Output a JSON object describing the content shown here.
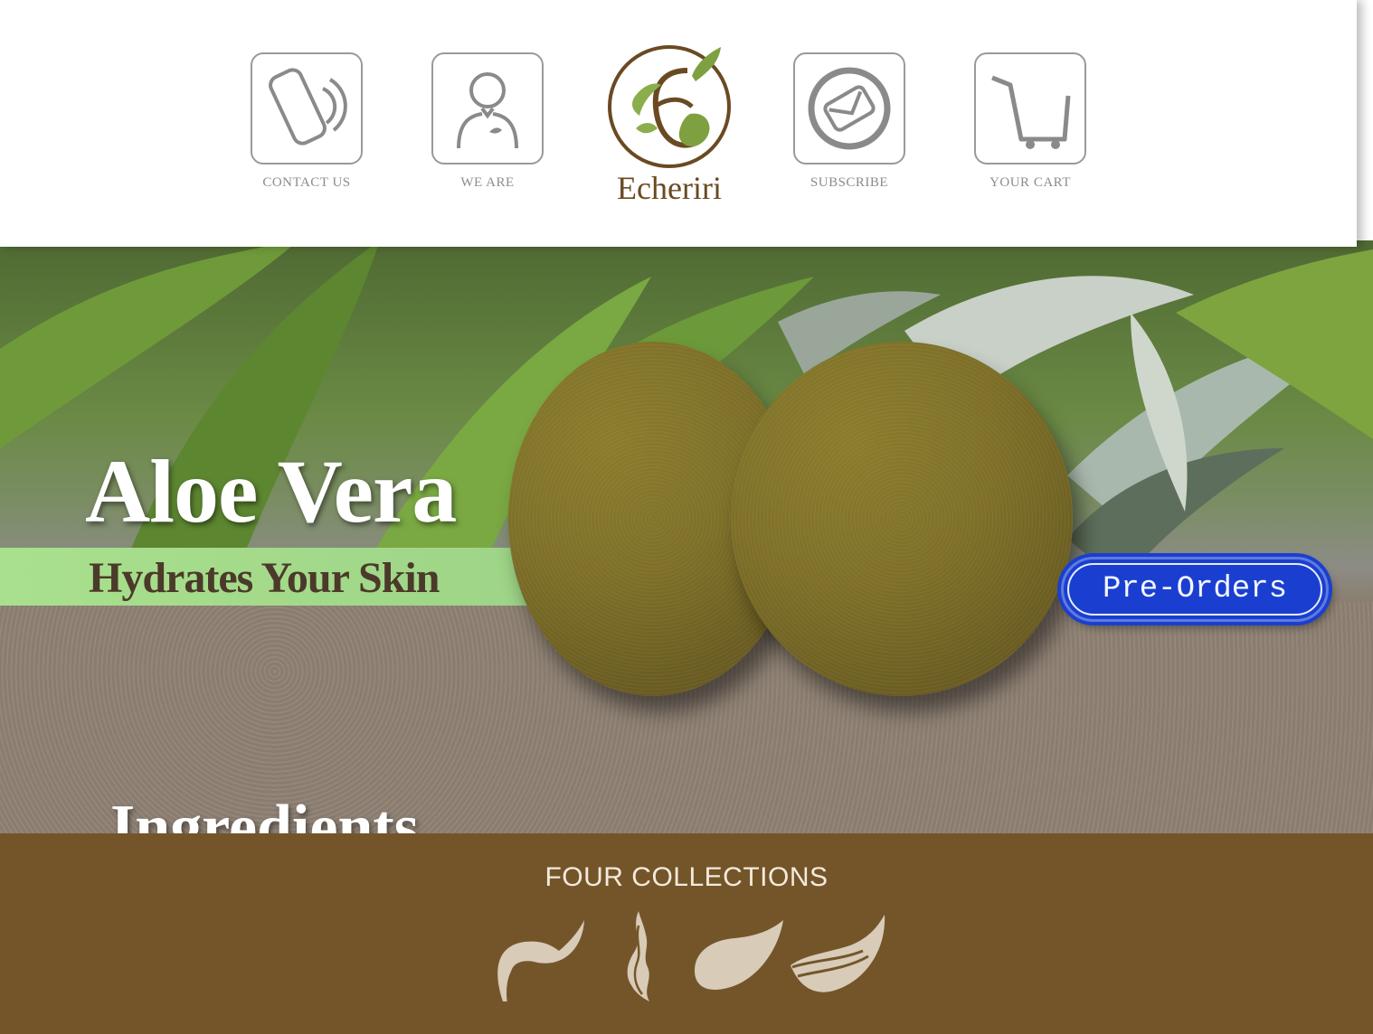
{
  "header": {
    "nav_left": [
      {
        "label": "CONTACT US",
        "icon": "phone-icon"
      },
      {
        "label": "WE ARE",
        "icon": "person-icon"
      }
    ],
    "logo": {
      "word": "Echeriri"
    },
    "nav_right": [
      {
        "label": "SUBSCRIBE",
        "icon": "envelope-icon"
      },
      {
        "label": "YOUR CART",
        "icon": "cart-icon"
      }
    ]
  },
  "hero": {
    "title": "Aloe Vera",
    "subtitle": "Hydrates Your Skin",
    "preorder_label": "Pre-Orders",
    "section_heading": "Ingredients"
  },
  "collections": {
    "title": "FOUR COLLECTIONS",
    "icons": [
      "leaf-icon",
      "flame-leaf-icon",
      "drop-leaf-icon",
      "wave-leaf-icon"
    ]
  },
  "colors": {
    "brand_brown": "#74552a",
    "logo_brown": "#6a4a22",
    "logo_green": "#7fa040",
    "preorder_blue": "#1a3fd0",
    "subtitle_band_green": "#a9e08d"
  }
}
